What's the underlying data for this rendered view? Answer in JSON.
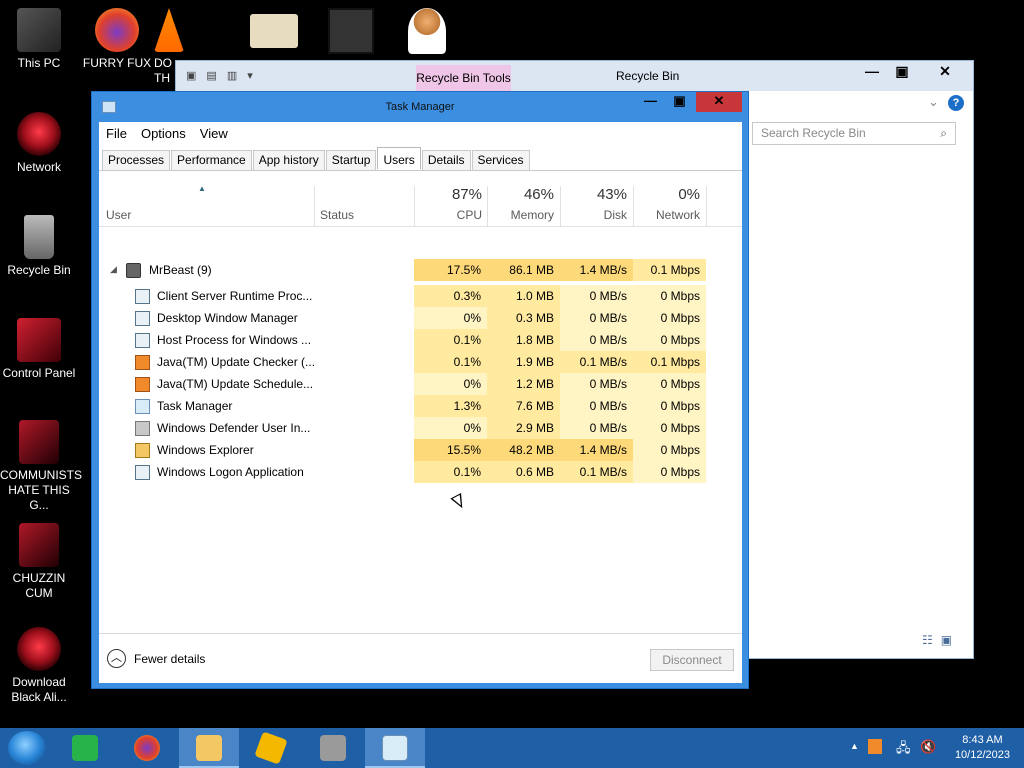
{
  "desktop_icons": [
    {
      "label": "This PC"
    },
    {
      "label": "FURRY FUX"
    },
    {
      "label": "DO\nTH"
    },
    {
      "label": "Network"
    },
    {
      "label": "Recycle Bin"
    },
    {
      "label": "Control Panel"
    },
    {
      "label": "COMMUNISTS HATE THIS G..."
    },
    {
      "label": "CHUZZIN CUM"
    },
    {
      "label": "Download Black Ali..."
    }
  ],
  "recycle_bin": {
    "tools_label": "Recycle Bin Tools",
    "title": "Recycle Bin",
    "search_placeholder": "Search Recycle Bin",
    "help": "?"
  },
  "task_manager": {
    "title": "Task Manager",
    "menu": [
      "File",
      "Options",
      "View"
    ],
    "tabs": [
      "Processes",
      "Performance",
      "App history",
      "Startup",
      "Users",
      "Details",
      "Services"
    ],
    "active_tab": "Users",
    "columns": {
      "user": "User",
      "status": "Status",
      "cpu": {
        "pct": "87%",
        "label": "CPU"
      },
      "memory": {
        "pct": "46%",
        "label": "Memory"
      },
      "disk": {
        "pct": "43%",
        "label": "Disk"
      },
      "network": {
        "pct": "0%",
        "label": "Network"
      }
    },
    "user_row": {
      "name": "MrBeast (9)",
      "cpu": "17.5%",
      "memory": "86.1 MB",
      "disk": "1.4 MB/s",
      "network": "0.1 Mbps"
    },
    "processes": [
      {
        "name": "Client Server Runtime Proc...",
        "icon": "win",
        "cpu": "0.3%",
        "memory": "1.0 MB",
        "disk": "0 MB/s",
        "network": "0 Mbps"
      },
      {
        "name": "Desktop Window Manager",
        "icon": "win",
        "cpu": "0%",
        "memory": "0.3 MB",
        "disk": "0 MB/s",
        "network": "0 Mbps"
      },
      {
        "name": "Host Process for Windows ...",
        "icon": "win",
        "cpu": "0.1%",
        "memory": "1.8 MB",
        "disk": "0 MB/s",
        "network": "0 Mbps"
      },
      {
        "name": "Java(TM) Update Checker (...",
        "icon": "java",
        "cpu": "0.1%",
        "memory": "1.9 MB",
        "disk": "0.1 MB/s",
        "network": "0.1 Mbps"
      },
      {
        "name": "Java(TM) Update Schedule...",
        "icon": "java",
        "cpu": "0%",
        "memory": "1.2 MB",
        "disk": "0 MB/s",
        "network": "0 Mbps"
      },
      {
        "name": "Task Manager",
        "icon": "task",
        "cpu": "1.3%",
        "memory": "7.6 MB",
        "disk": "0 MB/s",
        "network": "0 Mbps"
      },
      {
        "name": "Windows Defender User In...",
        "icon": "shield",
        "cpu": "0%",
        "memory": "2.9 MB",
        "disk": "0 MB/s",
        "network": "0 Mbps"
      },
      {
        "name": "Windows Explorer",
        "icon": "exp",
        "cpu": "15.5%",
        "memory": "48.2 MB",
        "disk": "1.4 MB/s",
        "network": "0 Mbps"
      },
      {
        "name": "Windows Logon Application",
        "icon": "win",
        "cpu": "0.1%",
        "memory": "0.6 MB",
        "disk": "0.1 MB/s",
        "network": "0 Mbps"
      }
    ],
    "fewer_details": "Fewer details",
    "disconnect": "Disconnect"
  },
  "taskbar": {
    "time": "8:43 AM",
    "date": "10/12/2023"
  },
  "colors": {
    "heat_light": "#fff4c4",
    "heat_mid": "#ffeaa0",
    "heat_strong": "#fdd97a",
    "taskbar": "#1f5fa6",
    "tm_frame": "#3c8fe0",
    "tm_close": "#c7373a"
  }
}
